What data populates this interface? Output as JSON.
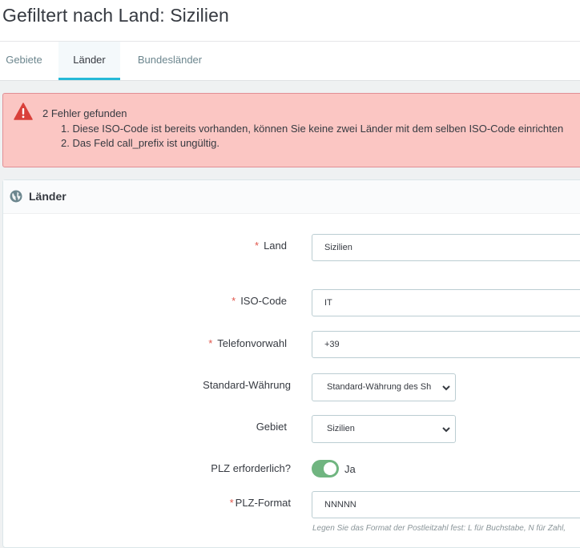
{
  "page": {
    "title": "Gefiltert nach Land: Sizilien"
  },
  "tabs": [
    {
      "label": "Gebiete",
      "active": false
    },
    {
      "label": "Länder",
      "active": true
    },
    {
      "label": "Bundesländer",
      "active": false
    }
  ],
  "alert": {
    "title": "2 Fehler gefunden",
    "errors": [
      "1. Diese ISO-Code ist bereits vorhanden, können Sie keine zwei Länder mit dem selben ISO-Code einrichten",
      "2. Das Feld call_prefix ist ungültig."
    ],
    "color": "#fbc6c3"
  },
  "panel": {
    "title": "Länder",
    "icon": "globe-icon"
  },
  "form": {
    "land": {
      "label": "Land",
      "value": "Sizilien",
      "required": true
    },
    "iso": {
      "label": "ISO-Code",
      "value": "IT",
      "required": true
    },
    "phone": {
      "label": "Telefonvorwahl",
      "value": "+39",
      "required": true
    },
    "currency": {
      "label": "Standard-Währung",
      "value": "Standard-Währung des Sh",
      "required": false
    },
    "zone": {
      "label": "Gebiet",
      "value": "Sizilien",
      "required": false
    },
    "zip_required": {
      "label": "PLZ erforderlich?",
      "value": "Ja",
      "on": true
    },
    "zip_format": {
      "label": "PLZ-Format",
      "value": "NNNNN",
      "required": true,
      "help": "Legen Sie das Format der Postleitzahl fest: L für Buchstabe, N für Zahl,"
    }
  },
  "colors": {
    "accent": "#25b9d7",
    "required": "#e0564b",
    "toggle_on": "#70b580",
    "alert_icon": "#d9403a"
  }
}
